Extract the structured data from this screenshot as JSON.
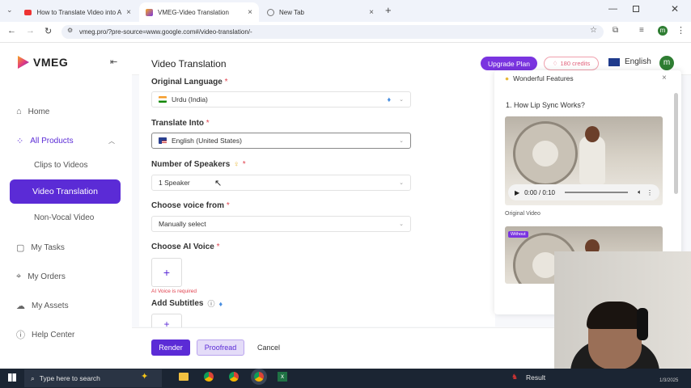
{
  "browser": {
    "tabs": [
      {
        "title": "How to Translate Video into An",
        "active": false
      },
      {
        "title": "VMEG-Video Translation",
        "active": true
      },
      {
        "title": "New Tab",
        "active": false
      }
    ],
    "url": "vmeg.pro/?pre-source=www.google.com#/video-translation/-"
  },
  "app": {
    "logo": "VMEG",
    "page_title": "Video Translation",
    "upgrade_label": "Upgrade Plan",
    "credits_label": "180 credits",
    "language_label": "English",
    "avatar_initial": "m"
  },
  "sidebar": {
    "home": "Home",
    "all_products": "All Products",
    "clips_to_videos": "Clips to Videos",
    "video_translation": "Video Translation",
    "non_vocal_video": "Non-Vocal Video",
    "my_tasks": "My Tasks",
    "my_orders": "My Orders",
    "my_assets": "My Assets",
    "help_center": "Help Center"
  },
  "form": {
    "original_language_label": "Original Language",
    "original_language_value": "Urdu (India)",
    "translate_into_label": "Translate Into",
    "translate_into_value": "English (United States)",
    "speakers_label": "Number of Speakers",
    "speakers_value": "1 Speaker",
    "voice_from_label": "Choose voice from",
    "voice_from_value": "Manually select",
    "ai_voice_label": "Choose AI Voice",
    "ai_voice_error": "AI Voice is required",
    "subtitles_label": "Add Subtitles",
    "required_mark": "*"
  },
  "actions": {
    "render": "Render",
    "proofread": "Proofread",
    "cancel": "Cancel"
  },
  "panel": {
    "title": "Wonderful Features",
    "section_title": "1. How Lip Sync Works?",
    "time": "0:00 / 0:10",
    "caption": "Original Video",
    "badge": "Without"
  },
  "taskbar": {
    "search_placeholder": "Type here to search",
    "result_label": "Result",
    "date": "1/3/2025"
  },
  "colors": {
    "accent": "#5b2bd6",
    "upgrade": "#7a34e0",
    "error": "#e0414e",
    "taskbar": "#1b2533"
  }
}
